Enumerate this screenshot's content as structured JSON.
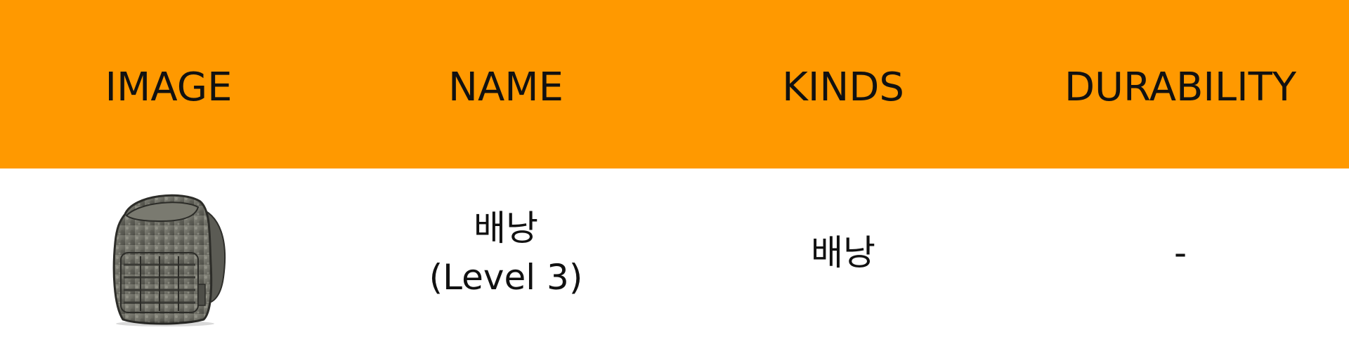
{
  "colors": {
    "header_bg": "#ff9900",
    "body_bg": "#ffffff",
    "text": "#111111"
  },
  "header": {
    "columns": [
      "IMAGE",
      "NAME",
      "KINDS",
      "DURABILITY"
    ]
  },
  "rows": [
    {
      "image_icon": "backpack-icon",
      "name_line1": "배낭",
      "name_line2": "(Level 3)",
      "kind": "배낭",
      "durability": "-"
    }
  ]
}
